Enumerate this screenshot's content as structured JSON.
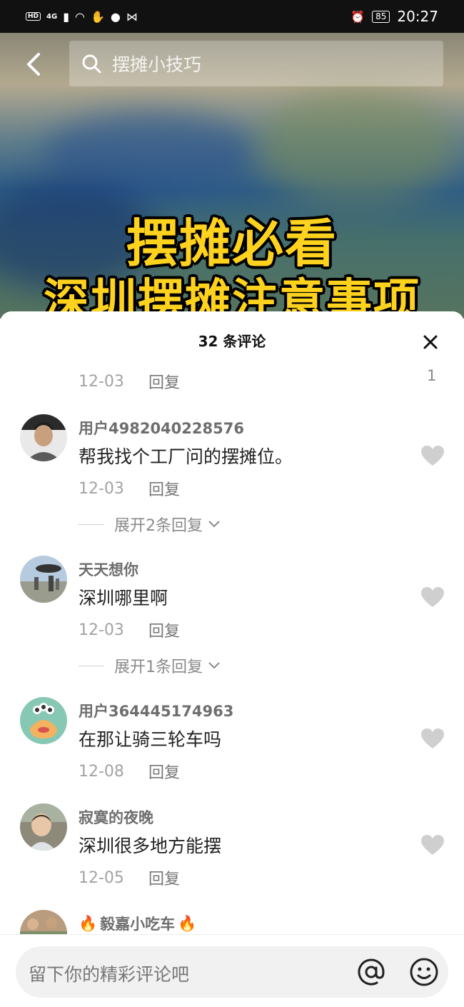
{
  "status_bar": {
    "hd": "HD",
    "signal": "4G",
    "battery": "85",
    "time": "20:27"
  },
  "search": {
    "query": "摆摊小技巧"
  },
  "video_overlay": {
    "line1": "摆摊必看",
    "line2": "深圳摆摊注意事项"
  },
  "panel": {
    "title": "32 条评论"
  },
  "partial_comment": {
    "date": "12-03",
    "reply_label": "回复",
    "like_count": "1"
  },
  "comments": [
    {
      "username": "用户4982040228576",
      "text": "帮我找个工厂问的摆摊位。",
      "date": "12-03",
      "reply_label": "回复",
      "expand_label": "展开2条回复"
    },
    {
      "username": "天天想你",
      "text": "深圳哪里啊",
      "date": "12-03",
      "reply_label": "回复",
      "expand_label": "展开1条回复"
    },
    {
      "username": "用户364445174963",
      "text": "在那让骑三轮车吗",
      "date": "12-08",
      "reply_label": "回复"
    },
    {
      "username": "寂寞的夜晚",
      "text": "深圳很多地方能摆",
      "date": "12-05",
      "reply_label": "回复"
    },
    {
      "username": "毅嘉小吃车"
    }
  ],
  "input": {
    "placeholder": "留下你的精彩评论吧"
  },
  "icons": {
    "back": "chevron-left-icon",
    "search": "search-icon",
    "close": "close-icon",
    "heart": "heart-icon",
    "at": "at-icon",
    "emoji": "emoji-icon",
    "fire": "fire-icon"
  },
  "colors": {
    "overlay_text": "#ffd21e",
    "heart": "#cfcfcf",
    "meta_text": "#a3a3a3"
  }
}
